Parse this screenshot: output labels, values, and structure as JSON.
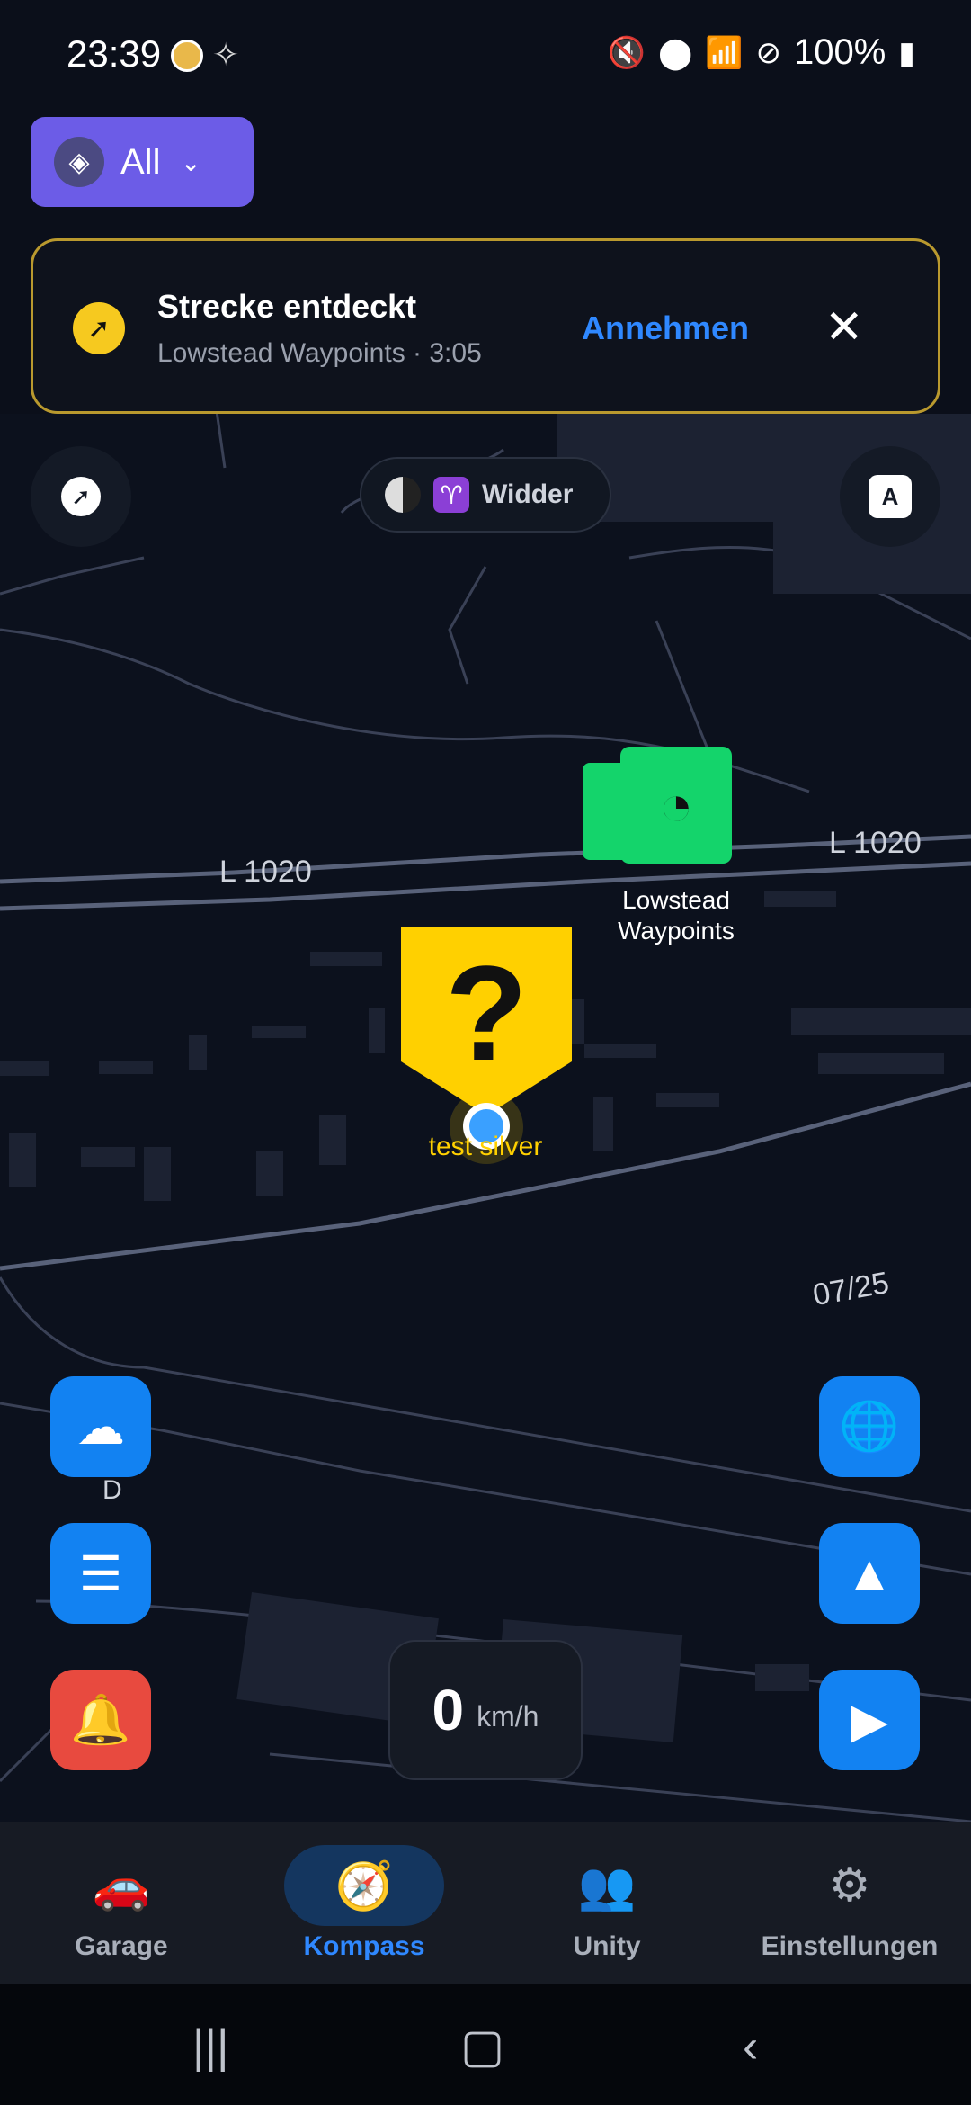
{
  "status": {
    "time": "23:39",
    "battery": "100%"
  },
  "filter": {
    "label": "All"
  },
  "notification": {
    "title": "Strecke entdeckt",
    "subtitle": "Lowstead Waypoints · 3:05",
    "accept_label": "Annehmen"
  },
  "zodiac": {
    "label": "Widder",
    "symbol": "♈"
  },
  "map": {
    "road_labels": [
      "L 1020",
      "L 1020",
      "07/25"
    ],
    "waypoint_label": "Lowstead\nWaypoints",
    "user_label": "test silver",
    "cloud_caption": "D"
  },
  "speed": {
    "value": "0",
    "unit": "km/h"
  },
  "nav": {
    "items": [
      {
        "label": "Garage"
      },
      {
        "label": "Kompass"
      },
      {
        "label": "Unity"
      },
      {
        "label": "Einstellungen"
      }
    ]
  },
  "colors": {
    "accent": "#2f88ff",
    "filter_bg": "#6c5ce7",
    "alert": "#e84a3f",
    "marker_green": "#14d46b",
    "marker_yellow": "#ffd000"
  }
}
